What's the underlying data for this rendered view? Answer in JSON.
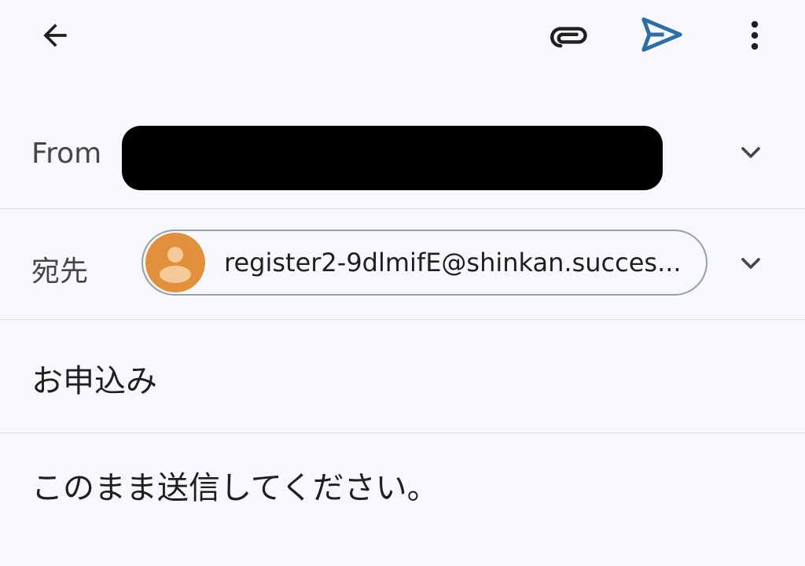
{
  "toolbar": {
    "back_icon": "arrow-left-icon",
    "attach_icon": "paperclip-icon",
    "send_icon": "send-icon",
    "more_icon": "more-vertical-icon",
    "send_color": "#2f6ea5"
  },
  "from": {
    "label": "From",
    "value_redacted": true
  },
  "to": {
    "label": "宛先",
    "recipient": "register2-9dlmifE@shinkan.succes...",
    "avatar_color": "#e1913b"
  },
  "subject": {
    "value": "お申込み"
  },
  "body": {
    "text": "このまま送信してください。"
  }
}
